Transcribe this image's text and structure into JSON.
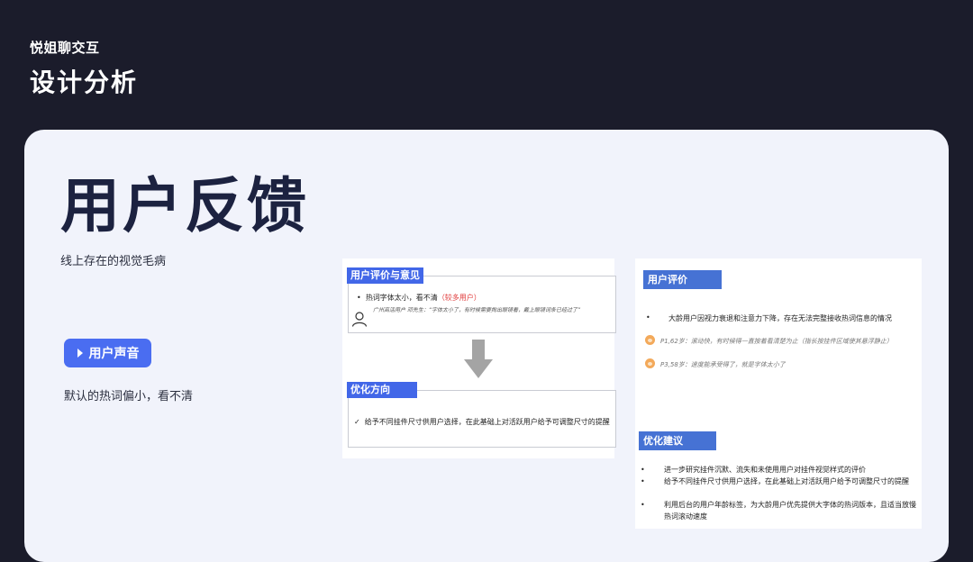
{
  "header": {
    "brand": "悦姐聊交互",
    "title": "设计分析"
  },
  "card": {
    "title": "用户反馈",
    "subtitle": "线上存在的视觉毛病",
    "voice_button": "用户声音",
    "voice_text": "默认的热词偏小，看不清"
  },
  "panel_a": {
    "eval_tag": "用户评价与意见",
    "bullet_main": "热词字体太小，看不清",
    "bullet_note": "（较多用户）",
    "quote": "广州高活用户 邓先生：“字体太小了，有时候需要掏出眼镜看，戴上眼镜词条已经过了”",
    "optimize_tag": "优化方向",
    "check_mark": "✓",
    "optimize_text": "给予不同挂件尺寸供用户选择，在此基础上对活跃用户给予可调整尺寸的提醒"
  },
  "panel_b": {
    "eval_tag": "用户评价",
    "bullet_main": "大龄用户因视力衰退和注意力下降，存在无法完整接收热词信息的情况",
    "feedback_1": "P1,62岁：滚动快，有时候得一直按着看清楚为止（指长按挂件区域使其悬浮静止）",
    "feedback_2": "P3,58岁：速度能承受得了，就是字体太小了",
    "suggest_tag": "优化建议",
    "suggestions": [
      "进一步研究挂件沉默、流失和未使用用户对挂件视觉样式的评价",
      "给予不同挂件尺寸供用户选择，在此基础上对活跃用户给予可调整尺寸的提醒",
      "利用后台的用户年龄标签，为大龄用户优先提供大字体的热词版本，且适当放慢热词滚动速度"
    ]
  },
  "colors": {
    "dark_bg": "#1b1c2b",
    "card_bg": "#f1f3fb",
    "accent": "#4a6df1",
    "tag_blue": "#4672d4",
    "note_red": "#e03b3b"
  },
  "icons": [
    "play-triangle-icon",
    "user-outline-icon",
    "down-arrow-icon",
    "avatar-icon"
  ]
}
